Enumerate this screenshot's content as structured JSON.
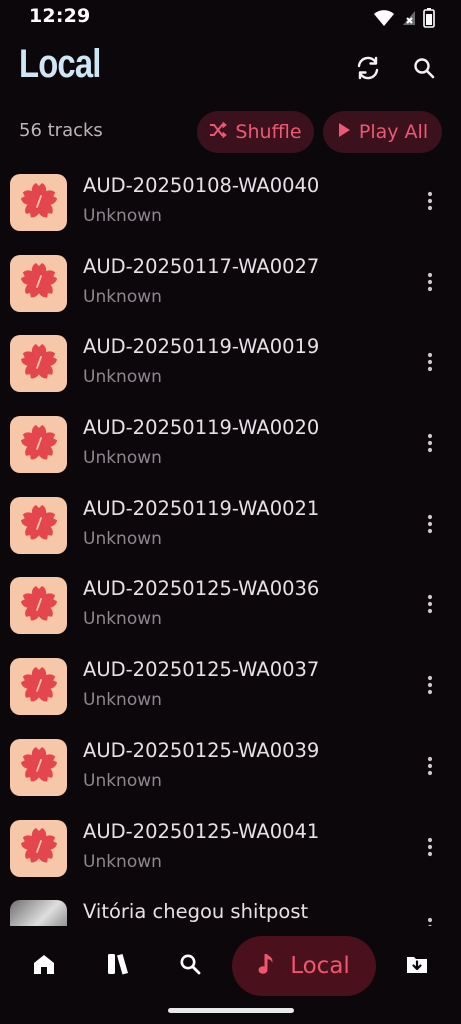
{
  "status_bar": {
    "time": "12:29",
    "icons": [
      "wifi-icon",
      "signal-icon",
      "battery-icon"
    ]
  },
  "header": {
    "title": "Local",
    "actions": [
      "refresh-icon",
      "search-icon"
    ]
  },
  "controls": {
    "track_count": "56 tracks",
    "shuffle_label": "Shuffle",
    "play_all_label": "Play All"
  },
  "tracks": [
    {
      "title": "AUD-20250108-WA0040",
      "artist": "Unknown",
      "art": "sakura-flower-icon"
    },
    {
      "title": "AUD-20250117-WA0027",
      "artist": "Unknown",
      "art": "sakura-flower-icon"
    },
    {
      "title": "AUD-20250119-WA0019",
      "artist": "Unknown",
      "art": "sakura-flower-icon"
    },
    {
      "title": "AUD-20250119-WA0020",
      "artist": "Unknown",
      "art": "sakura-flower-icon"
    },
    {
      "title": "AUD-20250119-WA0021",
      "artist": "Unknown",
      "art": "sakura-flower-icon"
    },
    {
      "title": "AUD-20250125-WA0036",
      "artist": "Unknown",
      "art": "sakura-flower-icon"
    },
    {
      "title": "AUD-20250125-WA0037",
      "artist": "Unknown",
      "art": "sakura-flower-icon"
    },
    {
      "title": "AUD-20250125-WA0039",
      "artist": "Unknown",
      "art": "sakura-flower-icon"
    },
    {
      "title": "AUD-20250125-WA0041",
      "artist": "Unknown",
      "art": "sakura-flower-icon"
    },
    {
      "title": "Vitória chegou shitpost",
      "artist": "",
      "art": "photo-thumbnail"
    }
  ],
  "bottom_nav": {
    "items": [
      "home-icon",
      "library-icon",
      "search-icon",
      "local-icon",
      "downloads-icon"
    ],
    "active_label": "Local"
  },
  "colors": {
    "background": "#0b070b",
    "accent": "#ef5874",
    "pill_background": "#3a111c",
    "title": "#cfe6f4",
    "album_art": "#f6c7a9",
    "flower": "#e4464f"
  }
}
